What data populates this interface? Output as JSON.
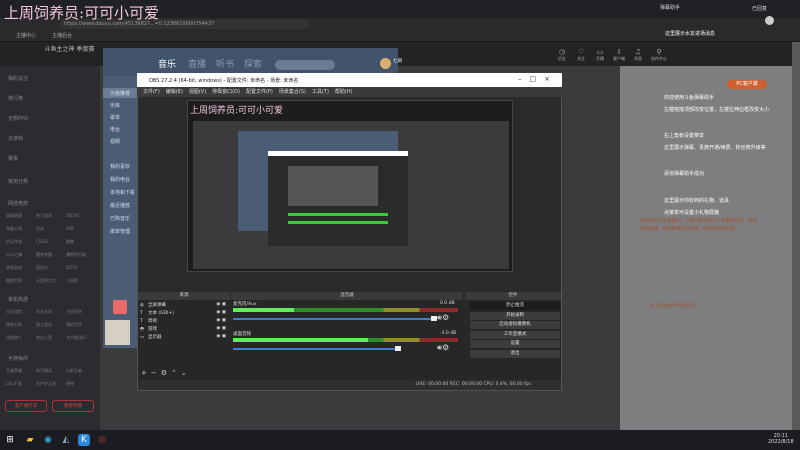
{
  "overlay_title": "上周饲养员:可可小可爱",
  "browser": {
    "url": "https://www.douyu.com/4513682?...=0.1236629000754437",
    "bookmarks": [
      "主播中心",
      "主播后台"
    ],
    "danmu_assistant": "弹幕助手",
    "logged_in": "已回复"
  },
  "header": {
    "logo": "斗鱼主之神 季度赛",
    "icons": [
      {
        "icon": "clock-icon",
        "label": "历史"
      },
      {
        "icon": "heart-icon",
        "label": "关注"
      },
      {
        "icon": "tv-icon",
        "label": "开播"
      },
      {
        "icon": "download-icon",
        "label": "客户端"
      },
      {
        "icon": "bell-icon",
        "label": "消息"
      },
      {
        "icon": "bulb-icon",
        "label": "创作中心"
      }
    ]
  },
  "sidebar": {
    "items": [
      "我的关注",
      "排行榜",
      "无限PPO",
      "云游戏",
      "赛事"
    ],
    "sections": [
      {
        "title": "常用分类",
        "items": []
      },
      {
        "title": "网游竞技",
        "items": [
          "英雄联盟",
          "热门游戏",
          "DOTA2",
          "穿越火线",
          "逆战",
          "DNF",
          "炉石传说",
          "CSGO",
          "魔兽",
          "cs沙之峰",
          "魔兽争霸",
          "魔兽怀旧服",
          "明星游戏",
          "冒险岛",
          "DOTA",
          "魔兽世界",
          "天涯明月刀",
          "三国杀"
        ]
      },
      {
        "title": "单机热游",
        "items": [
          "主机游戏",
          "永劫无间",
          "主机综合",
          "使命召唤",
          "独立游戏",
          "我的世界",
          "怪物猎人",
          "鬼谷八荒",
          "艾尔登法环"
        ]
      },
      {
        "title": "手游休闲",
        "items": [
          "王者荣耀",
          "和平精英",
          "火影忍者",
          "LOL手游",
          "金铲铲之战",
          "原神"
        ]
      }
    ],
    "buttons": [
      "客户端打开",
      "我要开播"
    ]
  },
  "music": {
    "tabs": [
      "音乐",
      "直播",
      "听书",
      "探索"
    ],
    "user": "七涧",
    "side": [
      "为我推荐",
      "乐库",
      "歌单",
      "电台",
      "视频",
      "我的喜欢",
      "我的电台",
      "本地和下载",
      "最近播放",
      "已购音乐",
      "歌单管理"
    ]
  },
  "obs": {
    "title": "OBS 27.2.4 (64-bit, windows) - 配置文件: 未命名 - 场景: 未命名",
    "menu": [
      "文件(F)",
      "编辑(E)",
      "视图(V)",
      "停靠窗口(D)",
      "配置文件(P)",
      "场景集合(S)",
      "工具(T)",
      "帮助(H)"
    ],
    "docks": {
      "sources": "来源",
      "mixer": "混音器",
      "controls": "控件"
    },
    "sources": [
      {
        "icon": "globe-icon",
        "name": "全屏弹幕"
      },
      {
        "icon": "text-icon",
        "name": "文本 (GDI+)"
      },
      {
        "icon": "text-icon",
        "name": "周榜"
      },
      {
        "icon": "gamepad-icon",
        "name": "游戏"
      },
      {
        "icon": "monitor-icon",
        "name": "显示器"
      }
    ],
    "mixer": [
      {
        "name": "麦克风/Aux",
        "db": "0.0 dB",
        "level": 0.27,
        "volume": 1.0
      },
      {
        "name": "桌面音频",
        "db": "-3.0 dB",
        "level": 0.6,
        "volume": 0.82
      }
    ],
    "controls": [
      "停止推流",
      "开始录制",
      "启动虚拟摄像机",
      "工作室模式",
      "设置",
      "退出"
    ],
    "status": "LIVE: 00:00:00   REC: 00:00:00   CPU: 0.4%, 60.00 fps"
  },
  "danmu": {
    "pc_button": "PC客户端",
    "messages": [
      "这里展示水友进场消息",
      "欢迎使用斗鱼弹幕助手",
      "左键拖拽顶部改变位置，左键拉伸边框改变大小",
      "右上角有设置菜单",
      "这里展示弹幕、贵族开通/续费、粉丝牌升级等",
      "添加弹幕助手成功",
      "这里展示你收到的礼物、道具",
      "点菜单可设置小礼物屏蔽"
    ],
    "notice": "欢迎来到斗鱼直播间。斗鱼严禁未成年人直播或打赏，倡导绿色直播，请勿传播违法违规、低俗色情等内容。",
    "tip": "专业流动助手申请成功"
  },
  "taskbar": {
    "time": "20:11",
    "date": "2022/8/18"
  }
}
